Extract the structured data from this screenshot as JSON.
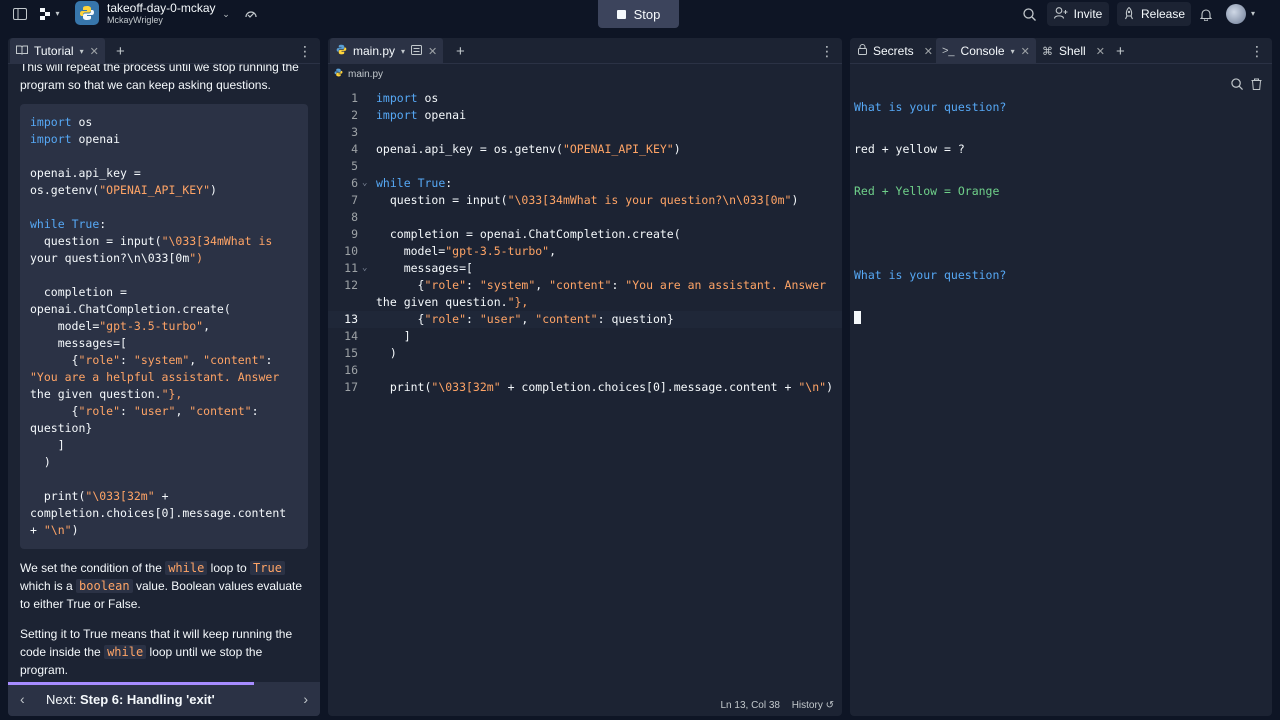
{
  "topbar": {
    "repl_title": "takeoff-day-0-mckay",
    "repl_owner": "MckayWrigley",
    "stop_label": "Stop",
    "invite_label": "Invite",
    "release_label": "Release"
  },
  "tutorial": {
    "tab_label": "Tutorial",
    "intro_text": "This will repeat the process until we stop running the program so that we can keep asking questions.",
    "code_lines": [
      "import os",
      "import openai",
      "",
      "openai.api_key =",
      "os.getenv(\"OPENAI_API_KEY\")",
      "",
      "while True:",
      "  question = input(\"\\033[34mWhat is",
      "your question?\\n\\033[0m\")",
      "",
      "  completion =",
      "openai.ChatCompletion.create(",
      "    model=\"gpt-3.5-turbo\",",
      "    messages=[",
      "      {\"role\": \"system\", \"content\":",
      "\"You are a helpful assistant. Answer",
      "the given question.\"},",
      "      {\"role\": \"user\", \"content\":",
      "question}",
      "    ]",
      "  )",
      "",
      "  print(\"\\033[32m\" +",
      "completion.choices[0].message.content",
      "+ \"\\n\")"
    ],
    "p1_a": "We set the condition of the ",
    "p1_code1": "while",
    "p1_b": " loop to ",
    "p1_code2": "True",
    "p1_c": " which is a ",
    "p1_code3": "boolean",
    "p1_d": " value. Boolean values evaluate to either True or False.",
    "p2_a": "Setting it to True means that it will keep running the code inside the ",
    "p2_code": "while",
    "p2_b": " loop until we stop the program.",
    "next_prefix": "Next: ",
    "next_step": "Step 6: Handling 'exit'",
    "progress": 0.79
  },
  "editor": {
    "tab_label": "main.py",
    "breadcrumb": "main.py",
    "lines": [
      {
        "n": "1",
        "t": "import os"
      },
      {
        "n": "2",
        "t": "import openai"
      },
      {
        "n": "3",
        "t": ""
      },
      {
        "n": "4",
        "t": "openai.api_key = os.getenv(\"OPENAI_API_KEY\")"
      },
      {
        "n": "5",
        "t": ""
      },
      {
        "n": "6",
        "t": "while True:"
      },
      {
        "n": "7",
        "t": "  question = input(\"\\033[34mWhat is your question?\\n\\033[0m\")"
      },
      {
        "n": "8",
        "t": ""
      },
      {
        "n": "9",
        "t": "  completion = openai.ChatCompletion.create("
      },
      {
        "n": "10",
        "t": "    model=\"gpt-3.5-turbo\","
      },
      {
        "n": "11",
        "t": "    messages=["
      },
      {
        "n": "12",
        "t": "      {\"role\": \"system\", \"content\": \"You are an assistant. Answer"
      },
      {
        "n": "",
        "t": "the given question.\"},"
      },
      {
        "n": "13",
        "t": "      {\"role\": \"user\", \"content\": question}"
      },
      {
        "n": "14",
        "t": "    ]"
      },
      {
        "n": "15",
        "t": "  )"
      },
      {
        "n": "16",
        "t": ""
      },
      {
        "n": "17",
        "t": "  print(\"\\033[32m\" + completion.choices[0].message.content + \"\\n\")"
      }
    ],
    "status_position": "Ln 13, Col 38",
    "status_history": "History"
  },
  "console": {
    "tab_secrets": "Secrets",
    "tab_console": "Console",
    "tab_shell": "Shell",
    "line1": "What is your question?",
    "line2": "red + yellow = ?",
    "line3": "Red + Yellow = Orange",
    "line4": "What is your question?"
  },
  "icons": {
    "sidebar": "sidebar-toggle-icon",
    "python": "python-logo-icon",
    "search": "search-icon",
    "bell": "bell-icon"
  },
  "colors": {
    "background": "#0e1525",
    "pane": "#1c2333",
    "keyword": "#56a8f5",
    "string": "#ffa466",
    "output": "#6fd08a",
    "progress": "#a68cff"
  }
}
